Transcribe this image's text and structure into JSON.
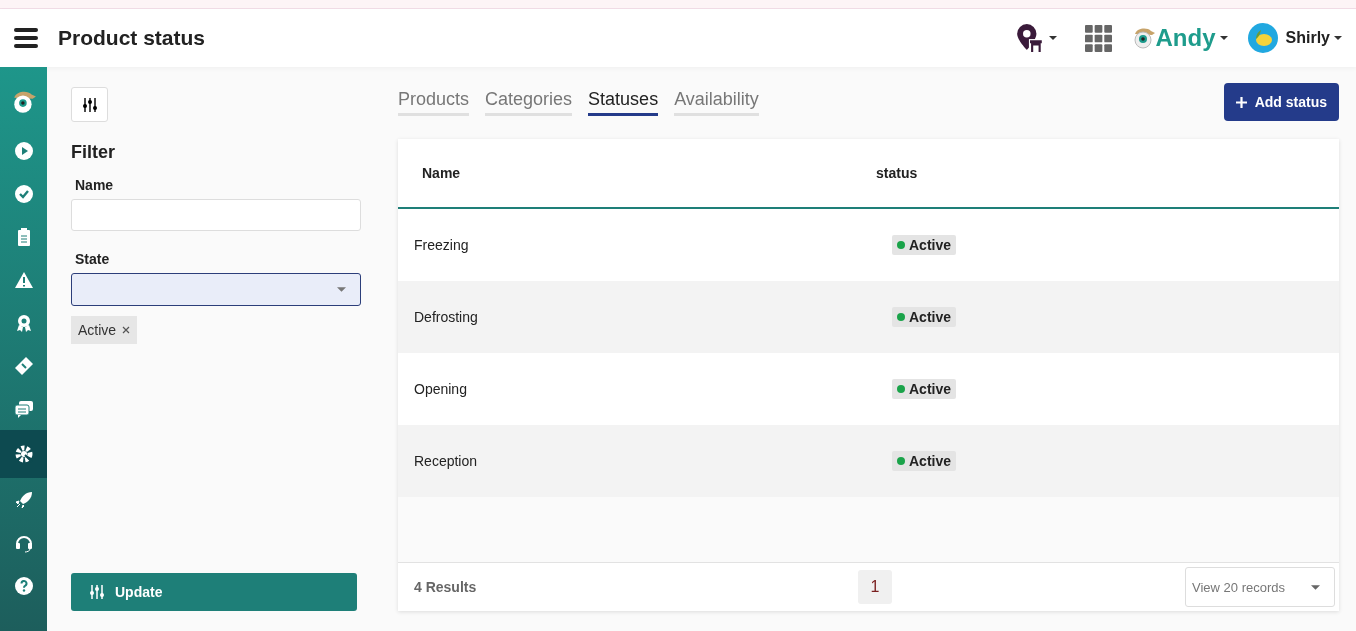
{
  "header": {
    "title": "Product status",
    "brand": "Andy",
    "user": "Shirly"
  },
  "sidebar": {
    "items": [
      {
        "selected": false
      },
      {
        "selected": false
      },
      {
        "selected": false
      },
      {
        "selected": false
      },
      {
        "selected": false
      },
      {
        "selected": false
      },
      {
        "selected": false
      },
      {
        "selected": true
      },
      {
        "selected": false
      },
      {
        "selected": false
      },
      {
        "selected": false
      }
    ]
  },
  "filter": {
    "title": "Filter",
    "name_label": "Name",
    "state_label": "State",
    "chips": [
      "Active"
    ],
    "update_button": "Update"
  },
  "tabs": [
    {
      "label": "Products",
      "selected": false
    },
    {
      "label": "Categories",
      "selected": false
    },
    {
      "label": "Statuses",
      "selected": true
    },
    {
      "label": "Availability",
      "selected": false
    }
  ],
  "add_button": "Add status",
  "table": {
    "columns": [
      "Name",
      "status"
    ],
    "rows": [
      {
        "name": "Freezing",
        "status": "Active"
      },
      {
        "name": "Defrosting",
        "status": "Active"
      },
      {
        "name": "Opening",
        "status": "Active"
      },
      {
        "name": "Reception",
        "status": "Active"
      }
    ]
  },
  "footer": {
    "results": "4 Results",
    "pages": [
      {
        "label": "1",
        "selected": true
      }
    ],
    "page_size": "View 20 records"
  }
}
